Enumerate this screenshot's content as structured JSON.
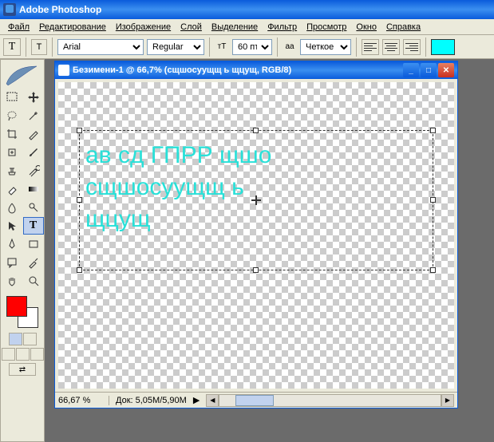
{
  "app": {
    "title": "Adobe Photoshop"
  },
  "menu": {
    "file": "Файл",
    "edit": "Редактирование",
    "image": "Изображение",
    "layer": "Слой",
    "select": "Выделение",
    "filter": "Фильтр",
    "view": "Просмотр",
    "window": "Окно",
    "help": "Справка"
  },
  "options": {
    "tool_letter": "T",
    "orient_letter": "T",
    "font": "Arial",
    "weight": "Regular",
    "size": "60 пт",
    "size_icon": "тТ",
    "aa_icon": "aа",
    "antialias": "Четкое",
    "text_color": "#00ffff"
  },
  "doc": {
    "title": "Безимени-1 @ 66,7% (сщшосуущщ ь щцущ, RGB/8)",
    "zoom": "66,67 %",
    "docsize": "Док: 5,05M/5,90M"
  },
  "canvas_text": {
    "line1": "ав сд ГПРР щшо",
    "line2": "сщшосуущщ ь",
    "line3": "щцущ"
  },
  "tools": {
    "marquee": "marquee",
    "move": "move",
    "lasso": "lasso",
    "wand": "magic-wand",
    "crop": "crop",
    "slice": "slice",
    "heal": "healing",
    "brush": "brush",
    "stamp": "clone-stamp",
    "history": "history-brush",
    "eraser": "eraser",
    "gradient": "gradient",
    "blur": "blur",
    "dodge": "dodge",
    "path": "path-select",
    "type": "type",
    "pen": "pen",
    "shape": "shape",
    "notes": "notes",
    "eyedrop": "eyedropper",
    "hand": "hand",
    "zoom": "zoom"
  },
  "colors": {
    "fg": "#ff0000",
    "bg": "#ffffff"
  }
}
